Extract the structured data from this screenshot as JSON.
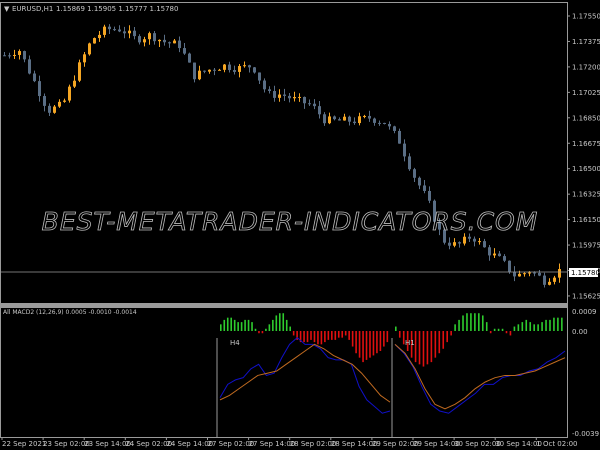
{
  "header": {
    "symbol": "EURUSD,H1",
    "ohlc": "1.15869 1.15905 1.15777 1.15780"
  },
  "watermark": "BEST-METATRADER-INDICATORS.COM",
  "colors": {
    "bull": "#f5a623",
    "bear": "#5a6e85",
    "hist_up": "#2ecc2e",
    "hist_down": "#e01010",
    "macd": "#1010c8",
    "signal": "#c06a20",
    "grid": "#9a9a9a"
  },
  "chart_data": {
    "type": "candlestick",
    "price_axis": [
      "1.17550",
      "1.17375",
      "1.17200",
      "1.17025",
      "1.16850",
      "1.16675",
      "1.16500",
      "1.16325",
      "1.16150",
      "1.15975",
      "1.15800",
      "1.15625"
    ],
    "price_range": [
      1.15625,
      1.1755
    ],
    "current_price": "1.15780",
    "closes": [
      1.1728,
      1.1732,
      1.1711,
      1.169,
      1.1694,
      1.1718,
      1.1739,
      1.1746,
      1.1746,
      1.1739,
      1.1742,
      1.1737,
      1.1735,
      1.1714,
      1.1718,
      1.1721,
      1.1719,
      1.1721,
      1.1701,
      1.1701,
      1.1697,
      1.1694,
      1.1683,
      1.1683,
      1.1683,
      1.1685,
      1.1682,
      1.167,
      1.1646,
      1.1628,
      1.1601,
      1.1597,
      1.1604,
      1.1594,
      1.1587,
      1.1576,
      1.158,
      1.1573,
      1.158
    ],
    "time_axis": [
      "22 Sep 2021",
      "23 Sep 02:00",
      "23 Sep 14:00",
      "24 Sep 02:00",
      "24 Sep 14:00",
      "27 Sep 02:00",
      "27 Sep 14:00",
      "28 Sep 02:00",
      "28 Sep 14:00",
      "29 Sep 02:00",
      "29 Sep 14:00",
      "30 Sep 02:00",
      "30 Sep 14:00",
      "1 Oct 02:00"
    ]
  },
  "indicator": {
    "title": "All MACD2 (12,26,9) 0.0005 -0.0010 -0.0014",
    "axis": [
      "0.0009",
      "0.00",
      "-0.0039"
    ],
    "range": [
      -0.0039,
      0.0009
    ],
    "panels": [
      "H4",
      "H1"
    ],
    "hist_h4": [
      0.0003,
      0.0005,
      0.0006,
      0.0006,
      0.0005,
      0.0004,
      0.0004,
      0.0005,
      0.0005,
      0.0004,
      0.0001,
      -0.0001,
      -0.0001,
      0.0001,
      0.0003,
      0.0005,
      0.0007,
      0.0008,
      0.0008,
      0.0005,
      0.0002,
      -0.0002,
      -0.0004,
      -0.0005,
      -0.0005,
      -0.0005,
      -0.0004,
      -0.0005,
      -0.0006,
      -0.0006,
      -0.0005,
      -0.0004,
      -0.0004,
      -0.0004,
      -0.0003,
      -0.0003,
      -0.0002,
      -0.0004,
      -0.0007,
      -0.001,
      -0.0012,
      -0.0014,
      -0.0013,
      -0.0012,
      -0.0011,
      -0.001,
      -0.0009,
      -0.0007,
      -0.0005
    ],
    "hist_h1": [
      0.0002,
      -0.0003,
      -0.0006,
      -0.0009,
      -0.0012,
      -0.0014,
      -0.0015,
      -0.0016,
      -0.0015,
      -0.0014,
      -0.0012,
      -0.001,
      -0.0008,
      -0.0005,
      -0.0002,
      0.0003,
      0.0005,
      0.0007,
      0.0008,
      0.0008,
      0.0008,
      0.0008,
      0.0007,
      0.0004,
      -0.0001,
      0.0001,
      0.0001,
      0.0001,
      -0.0001,
      -0.0002,
      0.0002,
      0.0003,
      0.0004,
      0.0005,
      0.0004,
      0.0003,
      0.0003,
      0.0004,
      0.0005,
      0.0005,
      0.0006,
      0.0006,
      0.0006
    ],
    "macd_h4": [
      -0.003,
      -0.0024,
      -0.0022,
      -0.0021,
      -0.0017,
      -0.0015,
      -0.002,
      -0.0019,
      -0.0012,
      -0.0006,
      -0.0003,
      -0.0006,
      -0.0006,
      -0.0008,
      -0.0012,
      -0.0013,
      -0.0013,
      -0.0015,
      -0.0025,
      -0.0031,
      -0.0034,
      -0.0037,
      -0.0036
    ],
    "signal_h4": [
      -0.0031,
      -0.0029,
      -0.0026,
      -0.0023,
      -0.002,
      -0.0019,
      -0.0018,
      -0.0015,
      -0.0012,
      -0.0009,
      -0.0006,
      -0.0008,
      -0.0011,
      -0.0013,
      -0.0015,
      -0.0019,
      -0.0024,
      -0.0029,
      -0.0032
    ],
    "macd_h1": [
      -0.0006,
      -0.001,
      -0.0016,
      -0.0025,
      -0.0033,
      -0.0036,
      -0.0037,
      -0.0034,
      -0.0031,
      -0.0028,
      -0.0024,
      -0.0024,
      -0.0021,
      -0.002,
      -0.002,
      -0.0018,
      -0.0017,
      -0.0014,
      -0.0012,
      -0.0009
    ],
    "signal_h1": [
      -0.0006,
      -0.001,
      -0.0017,
      -0.0026,
      -0.0033,
      -0.0035,
      -0.0033,
      -0.003,
      -0.0026,
      -0.0023,
      -0.0021,
      -0.002,
      -0.002,
      -0.0019,
      -0.0018,
      -0.0016,
      -0.0014,
      -0.0012
    ]
  }
}
